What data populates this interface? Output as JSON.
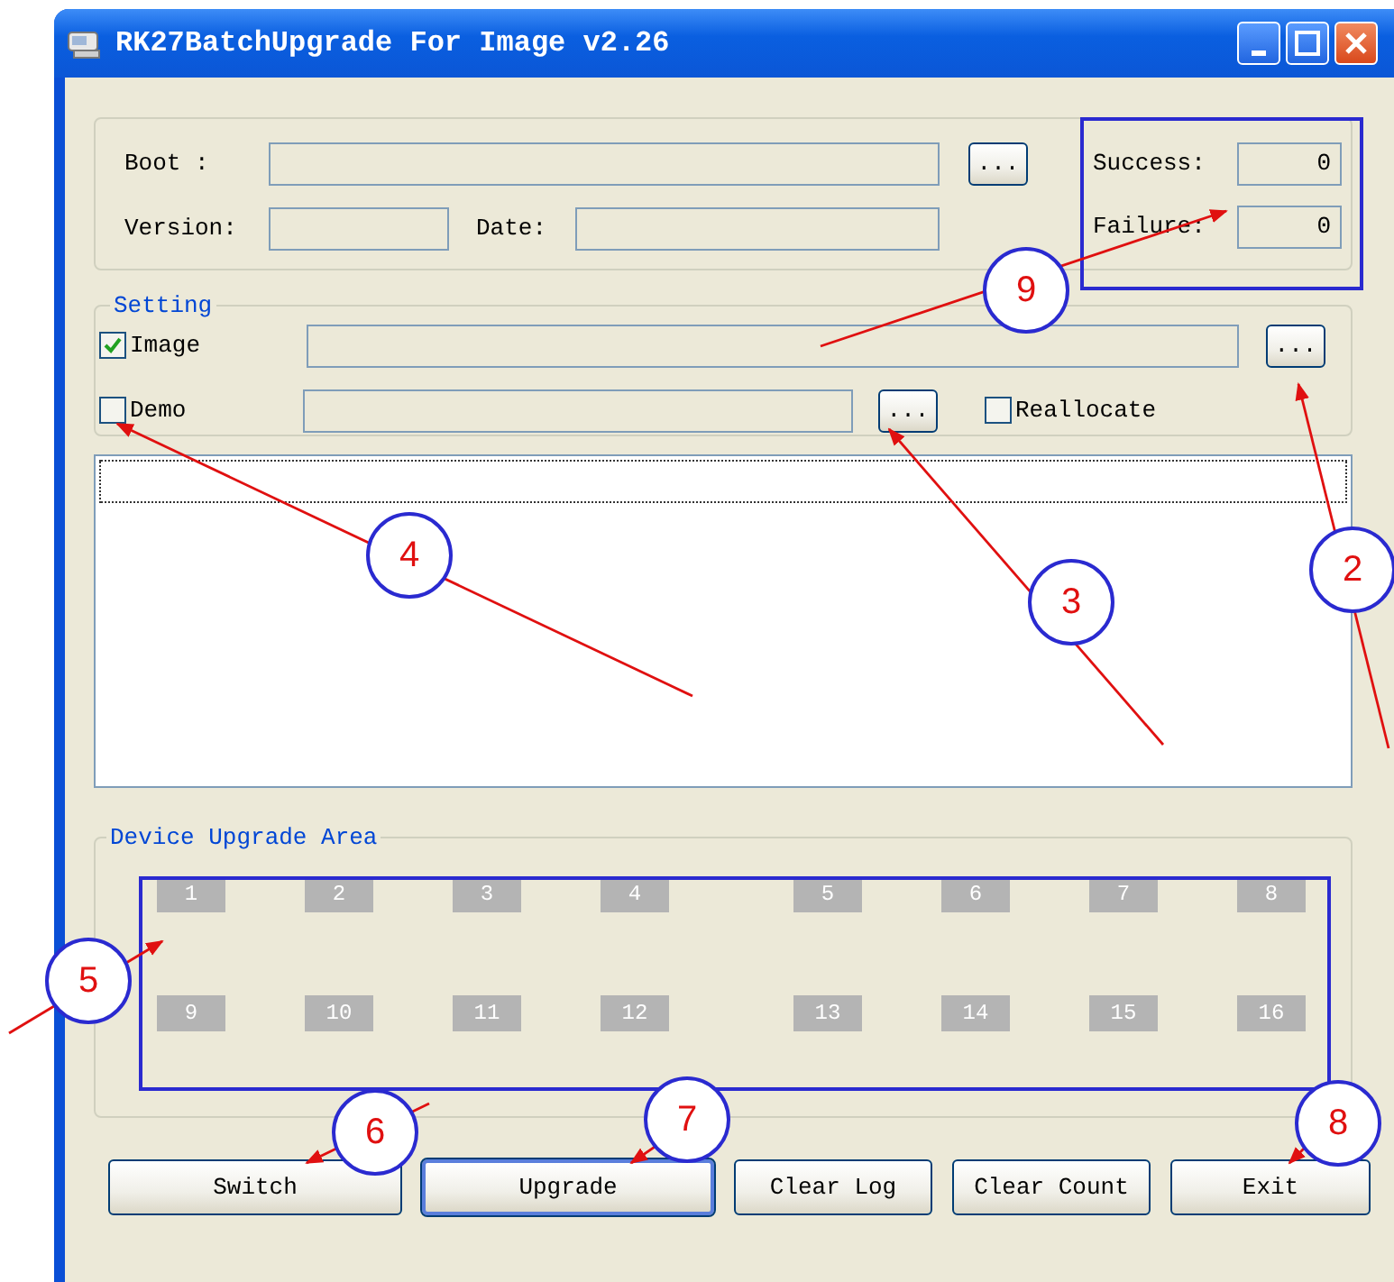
{
  "window": {
    "title": "RK27BatchUpgrade For Image v2.26"
  },
  "boot": {
    "label": "Boot :",
    "browse": "...",
    "version_label": "Version:",
    "date_label": "Date:"
  },
  "counters": [
    {
      "label": "Success:",
      "value": "0"
    },
    {
      "label": "Failure:",
      "value": "0"
    }
  ],
  "setting": {
    "legend": "Setting",
    "image": {
      "label": "Image",
      "checked": true
    },
    "image_browse": "...",
    "demo": {
      "label": "Demo",
      "checked": false
    },
    "demo_browse": "...",
    "reallocate": {
      "label": "Reallocate",
      "checked": false
    }
  },
  "device_area": {
    "legend": "Device Upgrade Area",
    "slots": [
      "1",
      "2",
      "3",
      "4",
      "5",
      "6",
      "7",
      "8",
      "9",
      "10",
      "11",
      "12",
      "13",
      "14",
      "15",
      "16"
    ]
  },
  "buttons": [
    {
      "label": "Switch",
      "focused": false
    },
    {
      "label": "Upgrade",
      "focused": true
    },
    {
      "label": "Clear Log",
      "focused": false
    },
    {
      "label": "Clear Count",
      "focused": false
    },
    {
      "label": "Exit",
      "focused": false
    }
  ],
  "callouts": [
    "9",
    "4",
    "3",
    "2",
    "5",
    "6",
    "7",
    "8"
  ]
}
